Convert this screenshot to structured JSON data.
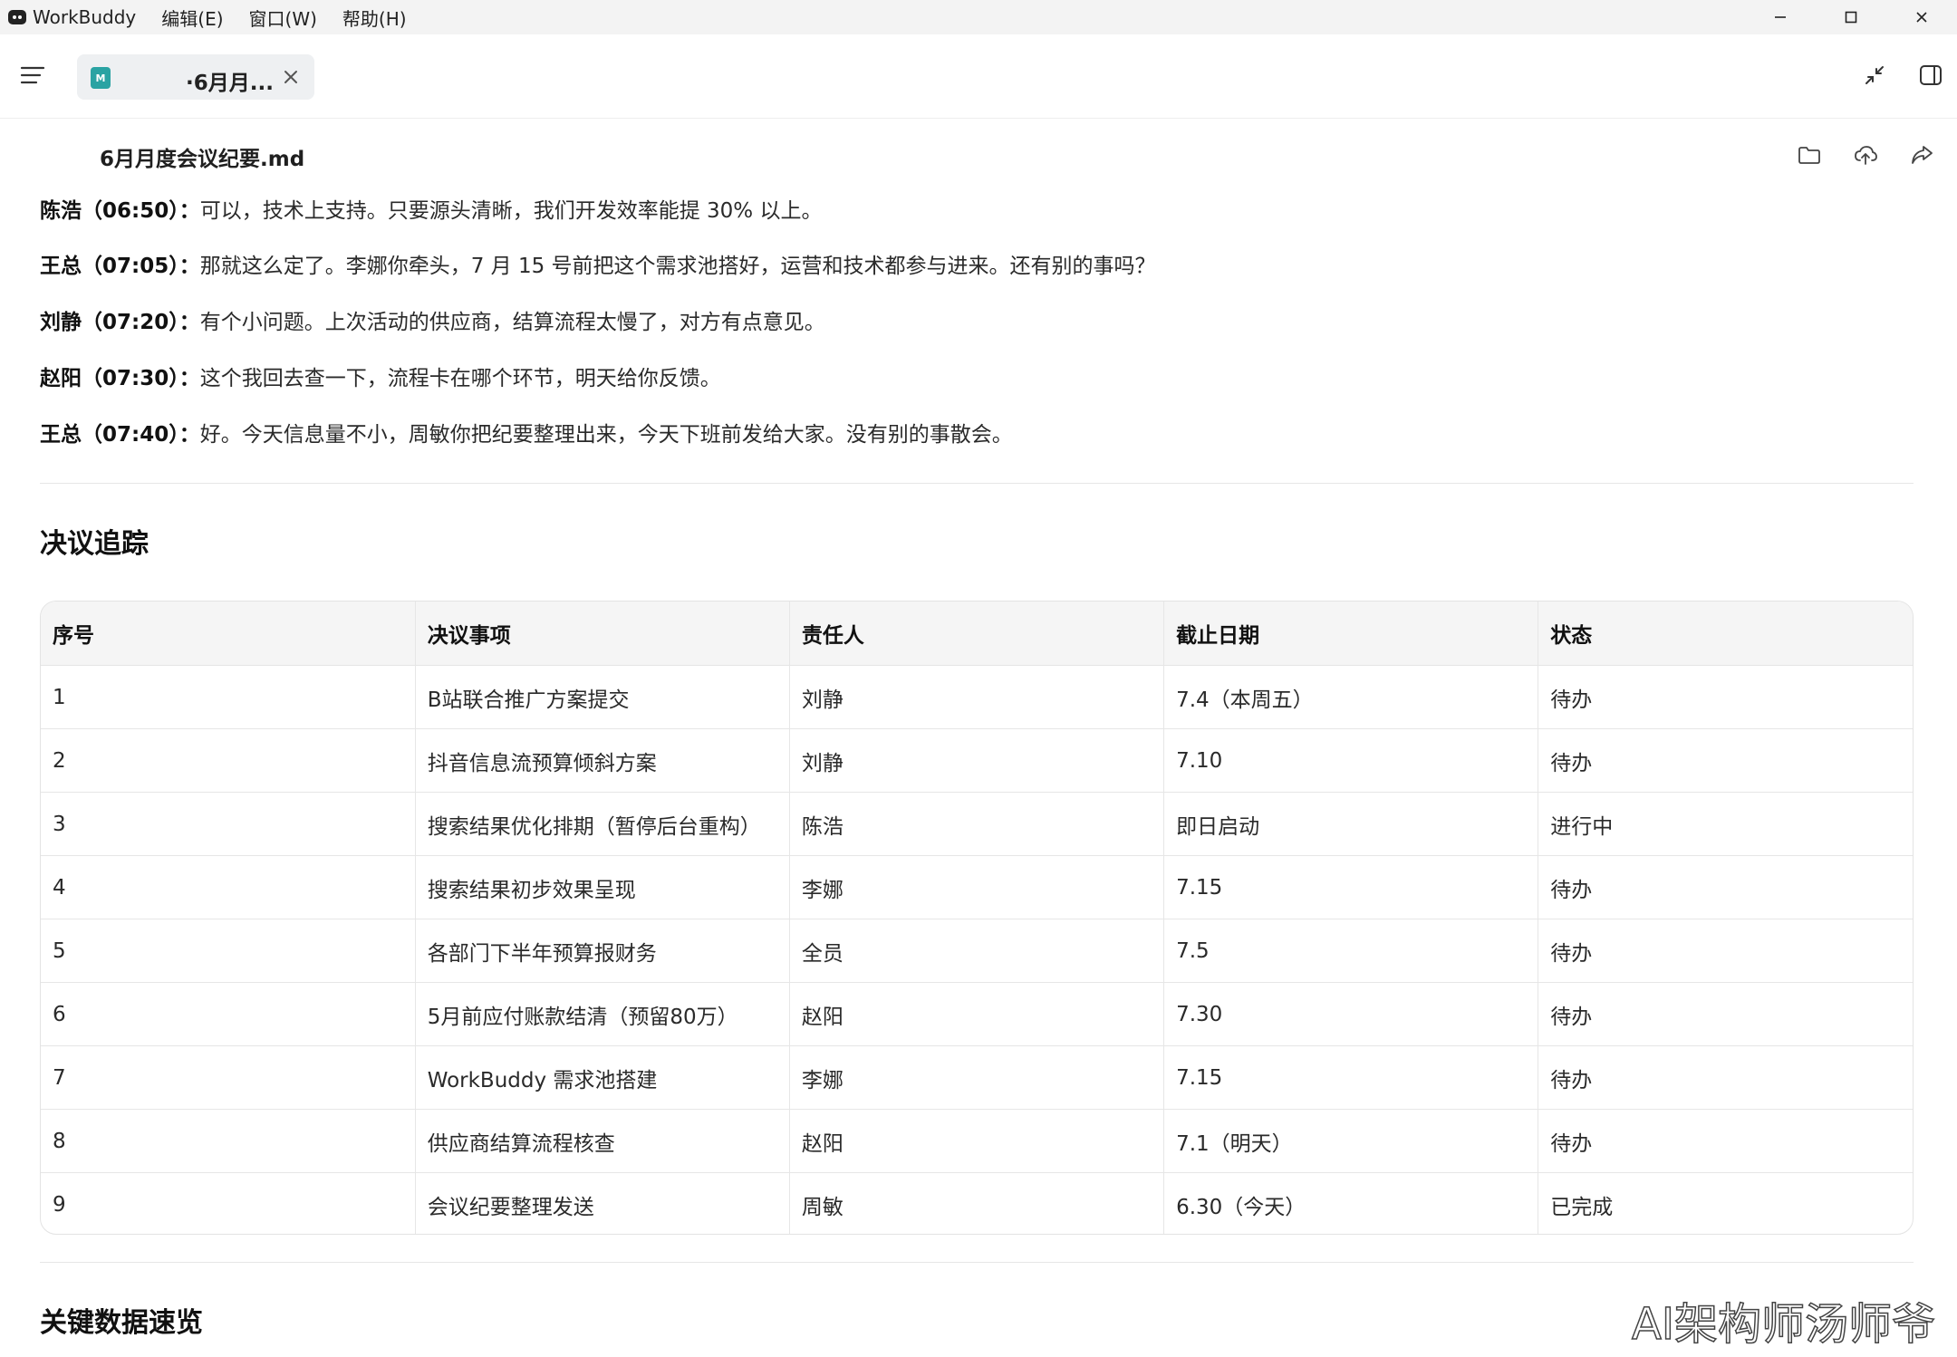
{
  "menubar": {
    "app_name": "WorkBuddy",
    "items": [
      "编辑(E)",
      "窗口(W)",
      "帮助(H)"
    ]
  },
  "tab": {
    "title": "·6月月...",
    "icon_letter": "M",
    "icon_color": "#2aa3a3"
  },
  "document": {
    "file_name": "6月月度会议纪要.md"
  },
  "transcript": [
    {
      "speaker": "陈浩（06:50）：",
      "text": "可以，技术上支持。只要源头清晰，我们开发效率能提 30% 以上。"
    },
    {
      "speaker": "王总（07:05）：",
      "text": "那就这么定了。李娜你牵头，7 月 15 号前把这个需求池搭好，运营和技术都参与进来。还有别的事吗？"
    },
    {
      "speaker": "刘静（07:20）：",
      "text": "有个小问题。上次活动的供应商，结算流程太慢了，对方有点意见。"
    },
    {
      "speaker": "赵阳（07:30）：",
      "text": "这个我回去查一下，流程卡在哪个环节，明天给你反馈。"
    },
    {
      "speaker": "王总（07:40）：",
      "text": "好。今天信息量不小，周敏你把纪要整理出来，今天下班前发给大家。没有别的事散会。"
    }
  ],
  "sections": {
    "resolution_tracking": "决议追踪",
    "key_data": "关键数据速览"
  },
  "table": {
    "headers": [
      "序号",
      "决议事项",
      "责任人",
      "截止日期",
      "状态"
    ],
    "rows": [
      [
        "1",
        "B站联合推广方案提交",
        "刘静",
        "7.4（本周五）",
        "待办"
      ],
      [
        "2",
        "抖音信息流预算倾斜方案",
        "刘静",
        "7.10",
        "待办"
      ],
      [
        "3",
        "搜索结果优化排期（暂停后台重构）",
        "陈浩",
        "即日启动",
        "进行中"
      ],
      [
        "4",
        "搜索结果初步效果呈现",
        "李娜",
        "7.15",
        "待办"
      ],
      [
        "5",
        "各部门下半年预算报财务",
        "全员",
        "7.5",
        "待办"
      ],
      [
        "6",
        "5月前应付账款结清（预留80万）",
        "赵阳",
        "7.30",
        "待办"
      ],
      [
        "7",
        "WorkBuddy 需求池搭建",
        "李娜",
        "7.15",
        "待办"
      ],
      [
        "8",
        "供应商结算流程核查",
        "赵阳",
        "7.1（明天）",
        "待办"
      ],
      [
        "9",
        "会议纪要整理发送",
        "周敏",
        "6.30（今天）",
        "已完成"
      ]
    ]
  },
  "watermark": "AI架构师汤师爷"
}
